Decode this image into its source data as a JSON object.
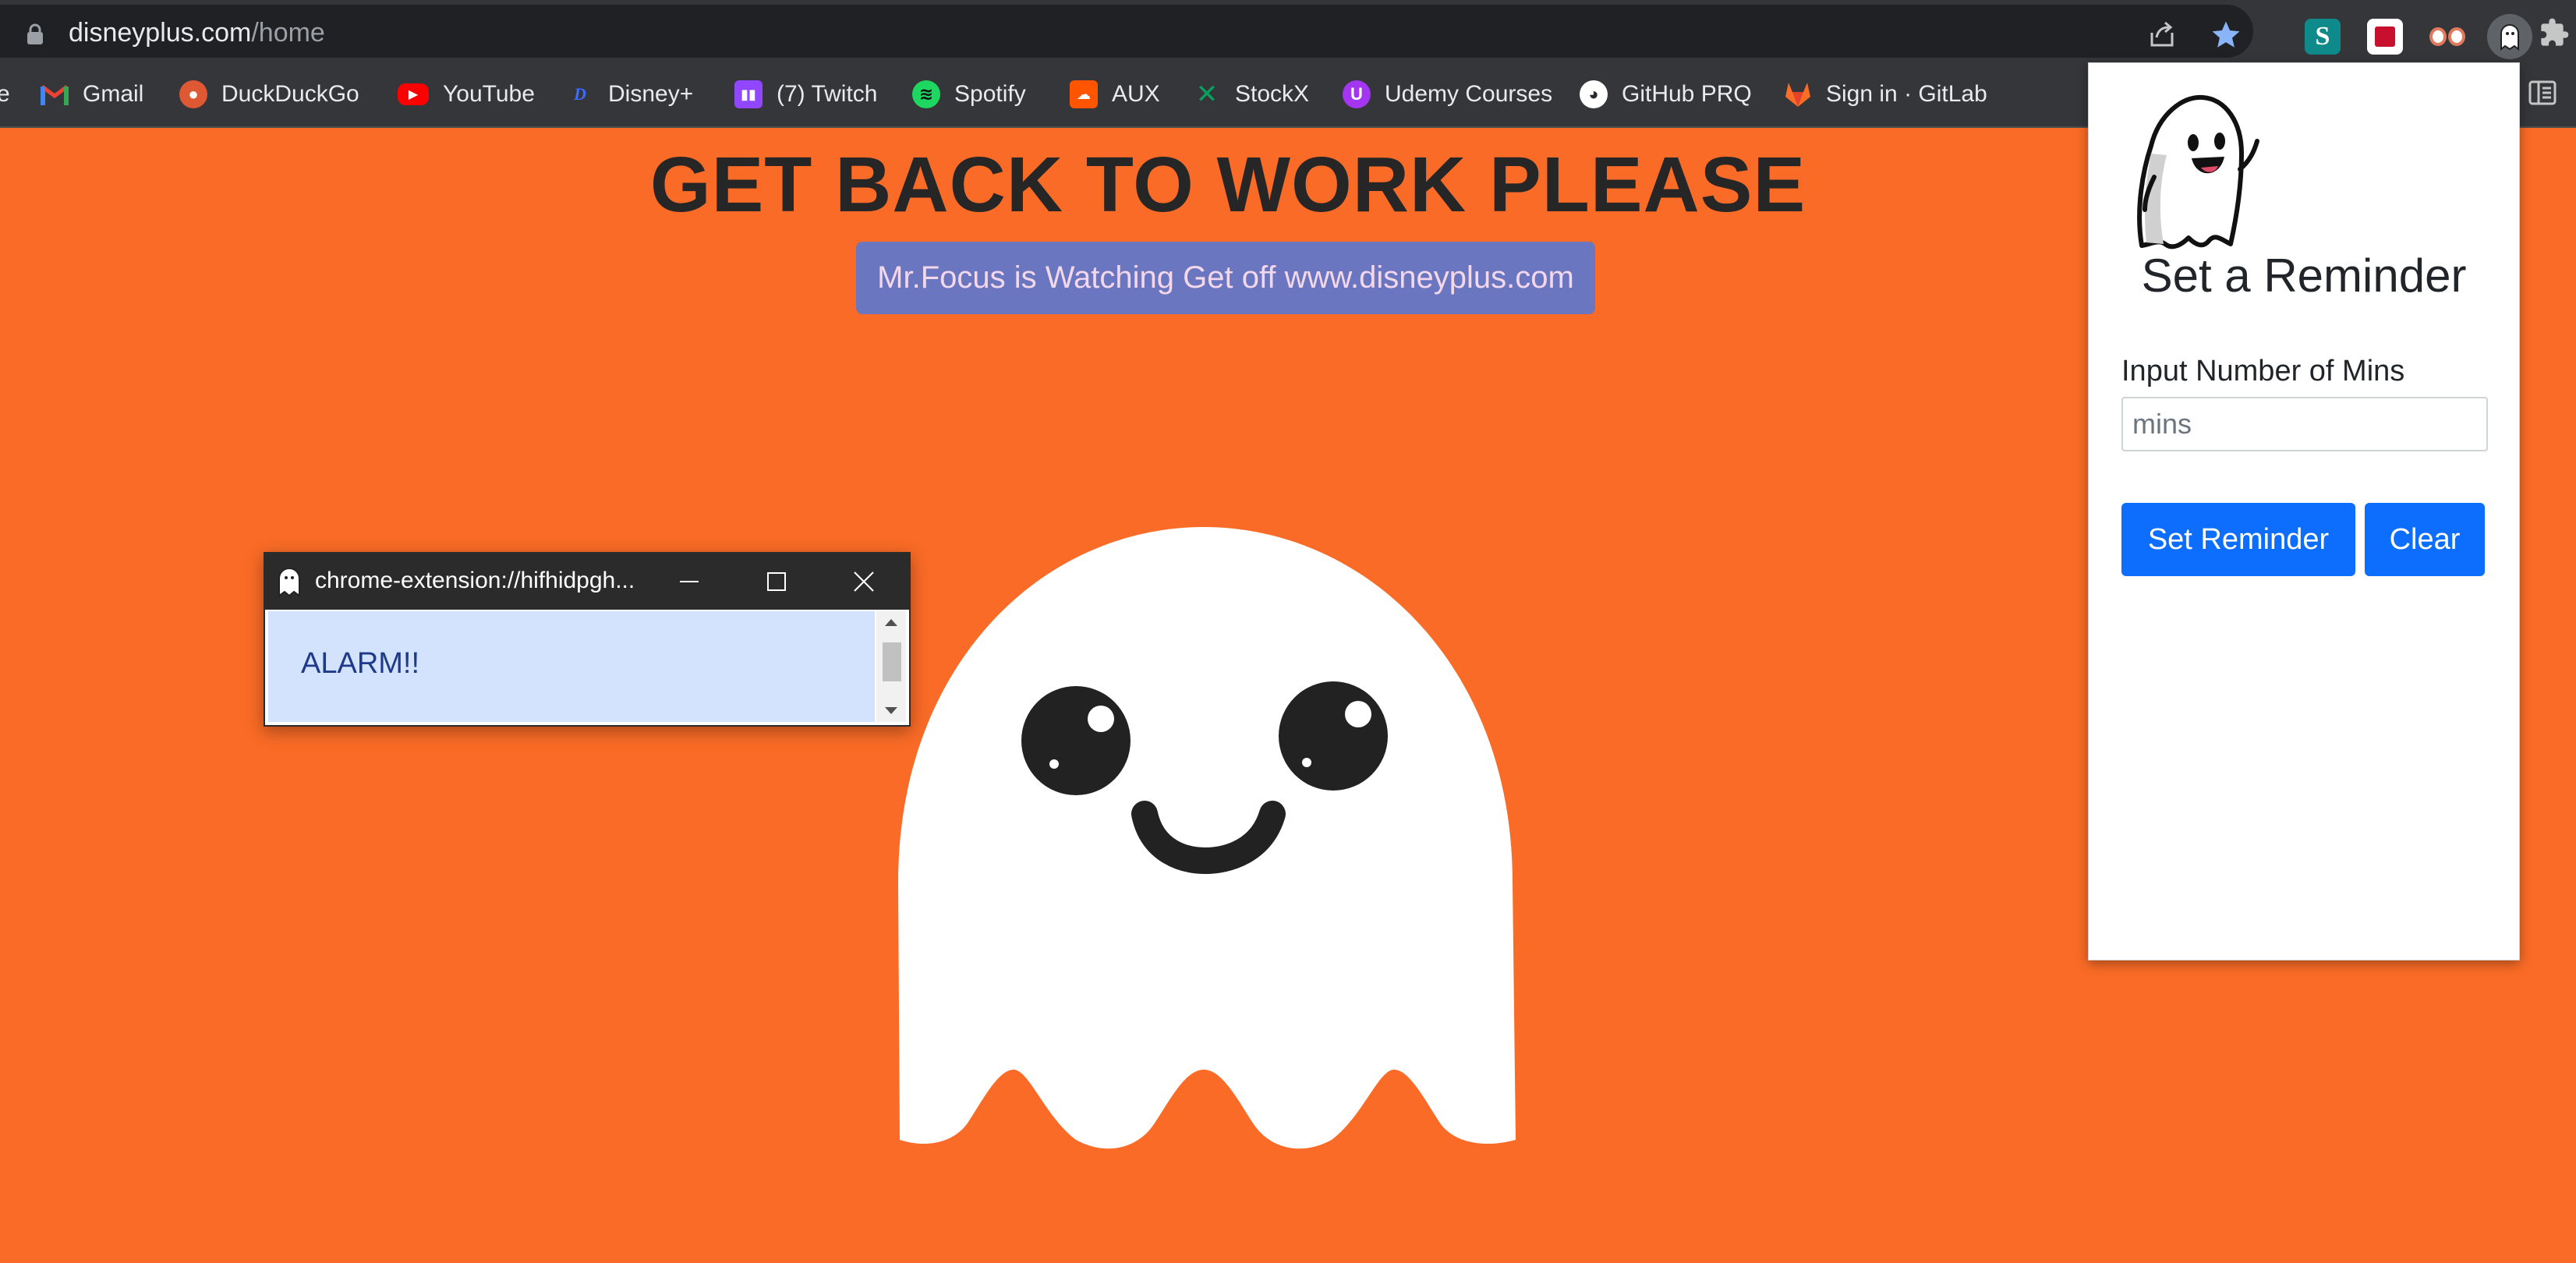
{
  "browser": {
    "url_host": "disneyplus.com",
    "url_path": "/home",
    "bookmarks": [
      {
        "label": "e",
        "icon": "folder-icon"
      },
      {
        "label": "Gmail",
        "icon": "gmail-icon"
      },
      {
        "label": "DuckDuckGo",
        "icon": "duckduckgo-icon"
      },
      {
        "label": "YouTube",
        "icon": "youtube-icon"
      },
      {
        "label": "Disney+",
        "icon": "disney-icon"
      },
      {
        "label": "(7) Twitch",
        "icon": "twitch-icon"
      },
      {
        "label": "Spotify",
        "icon": "spotify-icon"
      },
      {
        "label": "AUX",
        "icon": "soundcloud-icon"
      },
      {
        "label": "StockX",
        "icon": "stockx-icon"
      },
      {
        "label": "Udemy Courses",
        "icon": "udemy-icon"
      },
      {
        "label": "GitHub PRQ",
        "icon": "github-icon"
      },
      {
        "label": "Sign in · GitLab",
        "icon": "gitlab-icon"
      }
    ]
  },
  "page": {
    "title": "GET BACK TO WORK PLEASE",
    "banner": "Mr.Focus is Watching Get off www.disneyplus.com",
    "background_color": "#f96b26"
  },
  "alarm_window": {
    "title": "chrome-extension://hifhidpgh...",
    "message": "ALARM!!"
  },
  "extension_popup": {
    "title": "Set a Reminder",
    "input_label": "Input Number of Mins",
    "input_placeholder": "mins",
    "input_value": "",
    "set_button": "Set Reminder",
    "clear_button": "Clear",
    "button_color": "#0d6efd"
  }
}
